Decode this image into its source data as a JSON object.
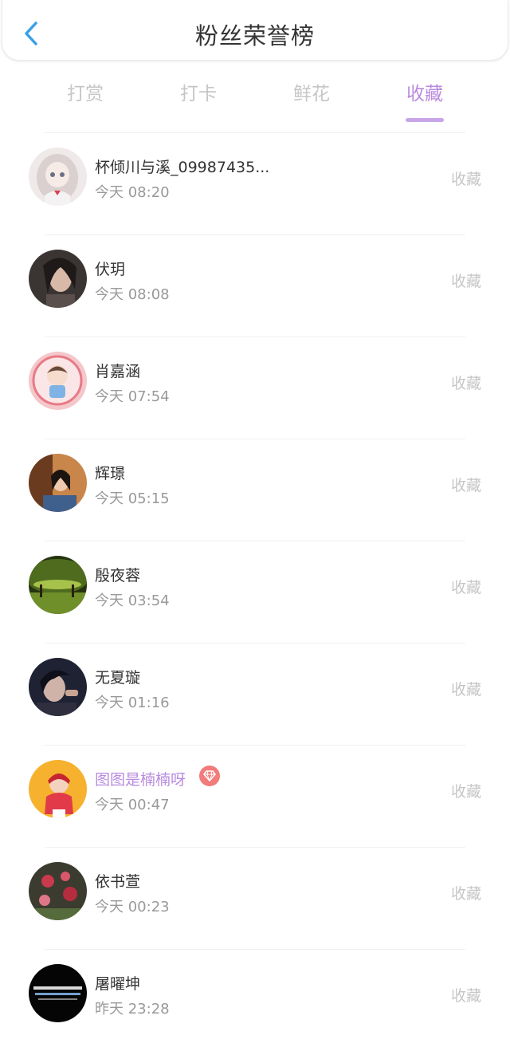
{
  "header": {
    "title": "粉丝荣誉榜",
    "back_icon": "chevron-left-icon"
  },
  "tabs": [
    {
      "label": "打赏",
      "active": false
    },
    {
      "label": "打卡",
      "active": false
    },
    {
      "label": "鲜花",
      "active": false
    },
    {
      "label": "收藏",
      "active": true
    }
  ],
  "colors": {
    "accent": "#b98adf",
    "back": "#3aa0e8",
    "muted": "#c6c6c6",
    "vip_badge": "#f27b7b"
  },
  "fans": [
    {
      "name": "杯倾川与溪_09987435...",
      "time": "今天 08:20",
      "action": "收藏",
      "vip": false,
      "avatar": "anime-girl"
    },
    {
      "name": "伏玥",
      "time": "今天 08:08",
      "action": "收藏",
      "vip": false,
      "avatar": "woman-dark"
    },
    {
      "name": "肖嘉涵",
      "time": "今天 07:54",
      "action": "收藏",
      "vip": false,
      "avatar": "cartoon-pink"
    },
    {
      "name": "辉璟",
      "time": "今天 05:15",
      "action": "收藏",
      "vip": false,
      "avatar": "woman-warm"
    },
    {
      "name": "殷夜蓉",
      "time": "今天 03:54",
      "action": "收藏",
      "vip": false,
      "avatar": "green-landscape"
    },
    {
      "name": "无夏璇",
      "time": "今天 01:16",
      "action": "收藏",
      "vip": false,
      "avatar": "man-dark"
    },
    {
      "name": "图图是楠楠呀",
      "time": "今天 00:47",
      "action": "收藏",
      "vip": true,
      "badge_icon": "diamond-icon",
      "avatar": "yellow-girl"
    },
    {
      "name": "依书萱",
      "time": "今天 00:23",
      "action": "收藏",
      "vip": false,
      "avatar": "flowers"
    },
    {
      "name": "屠曜坤",
      "time": "昨天 23:28",
      "action": "收藏",
      "vip": false,
      "avatar": "black-text"
    }
  ]
}
